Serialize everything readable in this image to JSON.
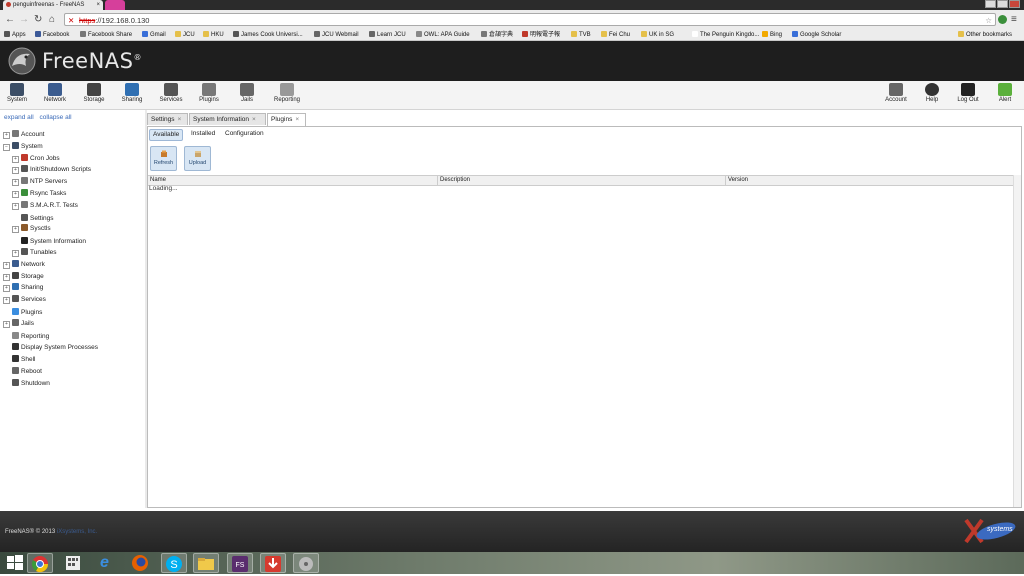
{
  "browser": {
    "tab_title": "penguinfreenas - FreeNAS",
    "tab_close": "×",
    "url_scheme": "https",
    "url_rest": "://192.168.0.130",
    "bookmarks": [
      {
        "label": "Apps",
        "color": "#555555"
      },
      {
        "label": "Facebook",
        "color": "#3b5998"
      },
      {
        "label": "Facebook Share",
        "color": "#777777"
      },
      {
        "label": "Gmail",
        "color": "#3a6fd8"
      },
      {
        "label": "JCU",
        "color": "#e5c04a"
      },
      {
        "label": "HKU",
        "color": "#e5c04a"
      },
      {
        "label": "James Cook Universi...",
        "color": "#555555"
      },
      {
        "label": "JCU Webmail",
        "color": "#666666"
      },
      {
        "label": "Learn JCU",
        "color": "#666666"
      },
      {
        "label": "OWL: APA Guide",
        "color": "#888888"
      },
      {
        "label": "倉頡字典",
        "color": "#777777"
      },
      {
        "label": "明報電子報",
        "color": "#c0392b"
      },
      {
        "label": "TVB",
        "color": "#e5c04a"
      },
      {
        "label": "Fei Chu",
        "color": "#e5c04a"
      },
      {
        "label": "UK in SG",
        "color": "#e5c04a"
      },
      {
        "label": "The Penguin Kingdo...",
        "color": "#ffffff"
      },
      {
        "label": "Bing",
        "color": "#f2a900"
      },
      {
        "label": "Google Scholar",
        "color": "#3a6fd8"
      }
    ],
    "other_bookmarks": "Other bookmarks"
  },
  "app": {
    "logo_text": "FreeNAS",
    "logo_mark": "®"
  },
  "toolbar": {
    "left": [
      {
        "label": "System",
        "icon": "system-icon"
      },
      {
        "label": "Network",
        "icon": "network-icon"
      },
      {
        "label": "Storage",
        "icon": "storage-icon"
      },
      {
        "label": "Sharing",
        "icon": "sharing-icon"
      },
      {
        "label": "Services",
        "icon": "services-icon"
      },
      {
        "label": "Plugins",
        "icon": "plugins-icon"
      },
      {
        "label": "Jails",
        "icon": "jails-icon"
      },
      {
        "label": "Reporting",
        "icon": "reporting-icon"
      }
    ],
    "right": [
      {
        "label": "Account",
        "icon": "account-icon"
      },
      {
        "label": "Help",
        "icon": "help-icon"
      },
      {
        "label": "Log Out",
        "icon": "logout-icon"
      },
      {
        "label": "Alert",
        "icon": "alert-icon"
      }
    ]
  },
  "tree": {
    "expand_all": "expand all",
    "collapse_all": "collapse all",
    "items": [
      {
        "label": "Account",
        "level": 0,
        "expander": "+"
      },
      {
        "label": "System",
        "level": 0,
        "expander": "−"
      },
      {
        "label": "Cron Jobs",
        "level": 1,
        "expander": "+"
      },
      {
        "label": "Init/Shutdown Scripts",
        "level": 1,
        "expander": "+"
      },
      {
        "label": "NTP Servers",
        "level": 1,
        "expander": "+"
      },
      {
        "label": "Rsync Tasks",
        "level": 1,
        "expander": "+"
      },
      {
        "label": "S.M.A.R.T. Tests",
        "level": 1,
        "expander": "+"
      },
      {
        "label": "Settings",
        "level": 1,
        "expander": ""
      },
      {
        "label": "Sysctls",
        "level": 1,
        "expander": "+"
      },
      {
        "label": "System Information",
        "level": 1,
        "expander": ""
      },
      {
        "label": "Tunables",
        "level": 1,
        "expander": "+"
      },
      {
        "label": "Network",
        "level": 0,
        "expander": "+"
      },
      {
        "label": "Storage",
        "level": 0,
        "expander": "+"
      },
      {
        "label": "Sharing",
        "level": 0,
        "expander": "+"
      },
      {
        "label": "Services",
        "level": 0,
        "expander": "+"
      },
      {
        "label": "Plugins",
        "level": 0,
        "expander": ""
      },
      {
        "label": "Jails",
        "level": 0,
        "expander": "+"
      },
      {
        "label": "Reporting",
        "level": 0,
        "expander": ""
      },
      {
        "label": "Display System Processes",
        "level": 0,
        "expander": ""
      },
      {
        "label": "Shell",
        "level": 0,
        "expander": ""
      },
      {
        "label": "Reboot",
        "level": 0,
        "expander": ""
      },
      {
        "label": "Shutdown",
        "level": 0,
        "expander": ""
      }
    ]
  },
  "tabs": [
    {
      "label": "Settings",
      "close": "×",
      "active": false
    },
    {
      "label": "System Information",
      "close": "×",
      "active": false
    },
    {
      "label": "Plugins",
      "close": "×",
      "active": true
    }
  ],
  "plugins": {
    "subtabs": [
      "Available",
      "Installed",
      "Configuration"
    ],
    "active_subtab": "Available",
    "refresh_label": "Refresh",
    "upload_label": "Upload",
    "columns": [
      "Name",
      "Description",
      "Version"
    ],
    "loading_text": "Loading..."
  },
  "footer": {
    "copyright": "FreeNAS® © 2013 ",
    "company": "iXsystems, Inc.",
    "logo_text": "systems"
  },
  "colors": {
    "header_bg": "#1e1e1e",
    "link": "#3a6ab8",
    "button_bg": "#d8e6f4"
  }
}
